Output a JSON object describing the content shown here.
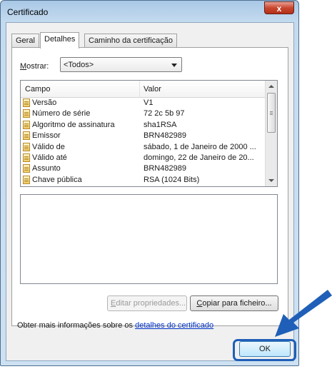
{
  "window": {
    "title": "Certificado",
    "close_symbol": "x"
  },
  "tabs": [
    {
      "label": "Geral",
      "active": false
    },
    {
      "label": "Detalhes",
      "active": true
    },
    {
      "label": "Caminho da certificação",
      "active": false
    }
  ],
  "show": {
    "label_mnemonic": "M",
    "label_rest": "ostrar:",
    "selected": "<Todos>"
  },
  "list": {
    "columns": [
      "Campo",
      "Valor"
    ],
    "rows": [
      {
        "field": "Versão",
        "value": "V1"
      },
      {
        "field": "Número de série",
        "value": "72 2c 5b 97"
      },
      {
        "field": "Algoritmo de assinatura",
        "value": "sha1RSA"
      },
      {
        "field": "Emissor",
        "value": "BRN482989"
      },
      {
        "field": "Válido de",
        "value": "sábado, 1 de Janeiro de 2000 ..."
      },
      {
        "field": "Válido até",
        "value": "domingo, 22 de Janeiro de 20..."
      },
      {
        "field": "Assunto",
        "value": "BRN482989"
      },
      {
        "field": "Chave pública",
        "value": "RSA (1024 Bits)"
      }
    ]
  },
  "buttons": {
    "edit_mnemonic": "E",
    "edit_rest": "ditar propriedades...",
    "copy_mnemonic": "C",
    "copy_rest": "opiar para ficheiro...",
    "ok": "OK"
  },
  "info": {
    "text": "Obter mais informações sobre os ",
    "link": "detalhes do certificado"
  },
  "colors": {
    "annotation": "#1f5fb8",
    "link": "#0033cc"
  }
}
